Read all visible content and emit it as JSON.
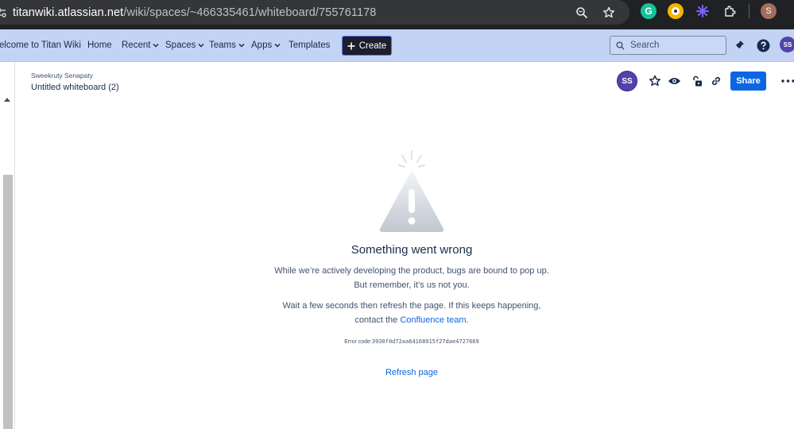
{
  "browser": {
    "url_host": "titanwiki.atlassian.net",
    "url_path": "/wiki/spaces/~466335461/whiteboard/755761178",
    "profile_initial": "S"
  },
  "nav": {
    "items": [
      {
        "label": "elcome to Titan Wiki",
        "dropdown": false
      },
      {
        "label": "Home",
        "dropdown": false
      },
      {
        "label": "Recent",
        "dropdown": true
      },
      {
        "label": "Spaces",
        "dropdown": true
      },
      {
        "label": "Teams",
        "dropdown": true
      },
      {
        "label": "Apps",
        "dropdown": true
      },
      {
        "label": "Templates",
        "dropdown": false
      }
    ],
    "create_label": "Create",
    "search_placeholder": "Search",
    "avatar_initials": "SS"
  },
  "page": {
    "breadcrumb": "Sweekruty Senapaty",
    "title": "Untitled whiteboard (2)",
    "avatar_initials": "SS",
    "share_label": "Share"
  },
  "error": {
    "title": "Something went wrong",
    "line1": "While we’re actively developing the product, bugs are bound to pop up.",
    "line2": "But remember, it’s us not you.",
    "line3": "Wait a few seconds then refresh the page. If this keeps happening,",
    "line4_prefix": "contact the",
    "line4_link": "Confluence team",
    "line4_suffix": ".",
    "code_label": "Error code:",
    "code_value": "3930f0d72aa64168915f27dae4727669",
    "refresh_label": "Refresh page"
  },
  "colors": {
    "nav_bg": "#c2d3f4",
    "accent_blue": "#0c66e4",
    "avatar_purple": "#5243aa",
    "create_bg": "#1d1d2b"
  }
}
